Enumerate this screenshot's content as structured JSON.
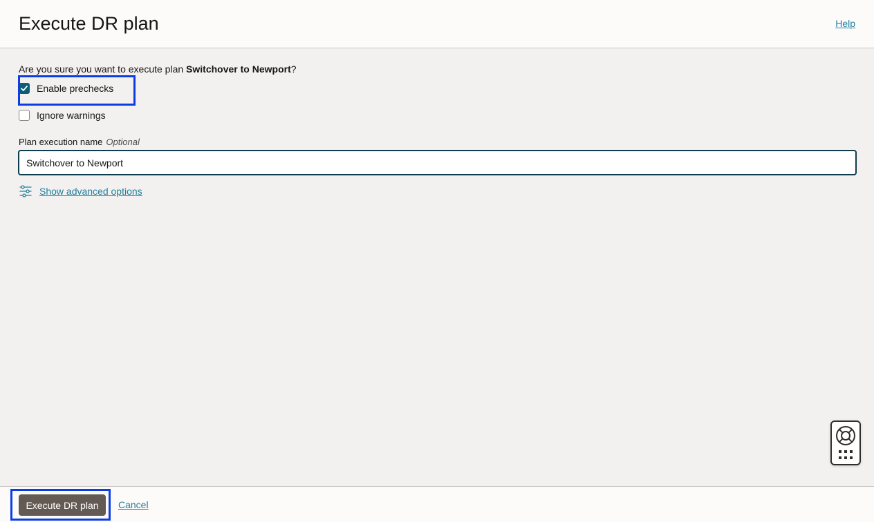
{
  "header": {
    "title": "Execute DR plan",
    "help_label": "Help"
  },
  "form": {
    "question_prefix": "Are you sure you want to execute plan ",
    "plan_name": "Switchover to Newport",
    "question_suffix": "?",
    "enable_prechecks": {
      "label": "Enable prechecks",
      "checked": true
    },
    "ignore_warnings": {
      "label": "Ignore warnings",
      "checked": false
    },
    "execution_name_label": "Plan execution name",
    "execution_name_optional": "Optional",
    "execution_name_value": "Switchover to Newport",
    "advanced_options_label": "Show advanced options"
  },
  "footer": {
    "execute_label": "Execute DR plan",
    "cancel_label": "Cancel"
  },
  "colors": {
    "accent_link": "#227e9e",
    "checkbox_checked": "#0d5c78",
    "primary_button": "#635a54",
    "highlight": "#0b3de2"
  },
  "icons": {
    "advanced": "sliders-icon",
    "help_widget": "lifebuoy-icon",
    "help_widget_secondary": "grid-dots-icon",
    "check": "checkmark-icon"
  }
}
